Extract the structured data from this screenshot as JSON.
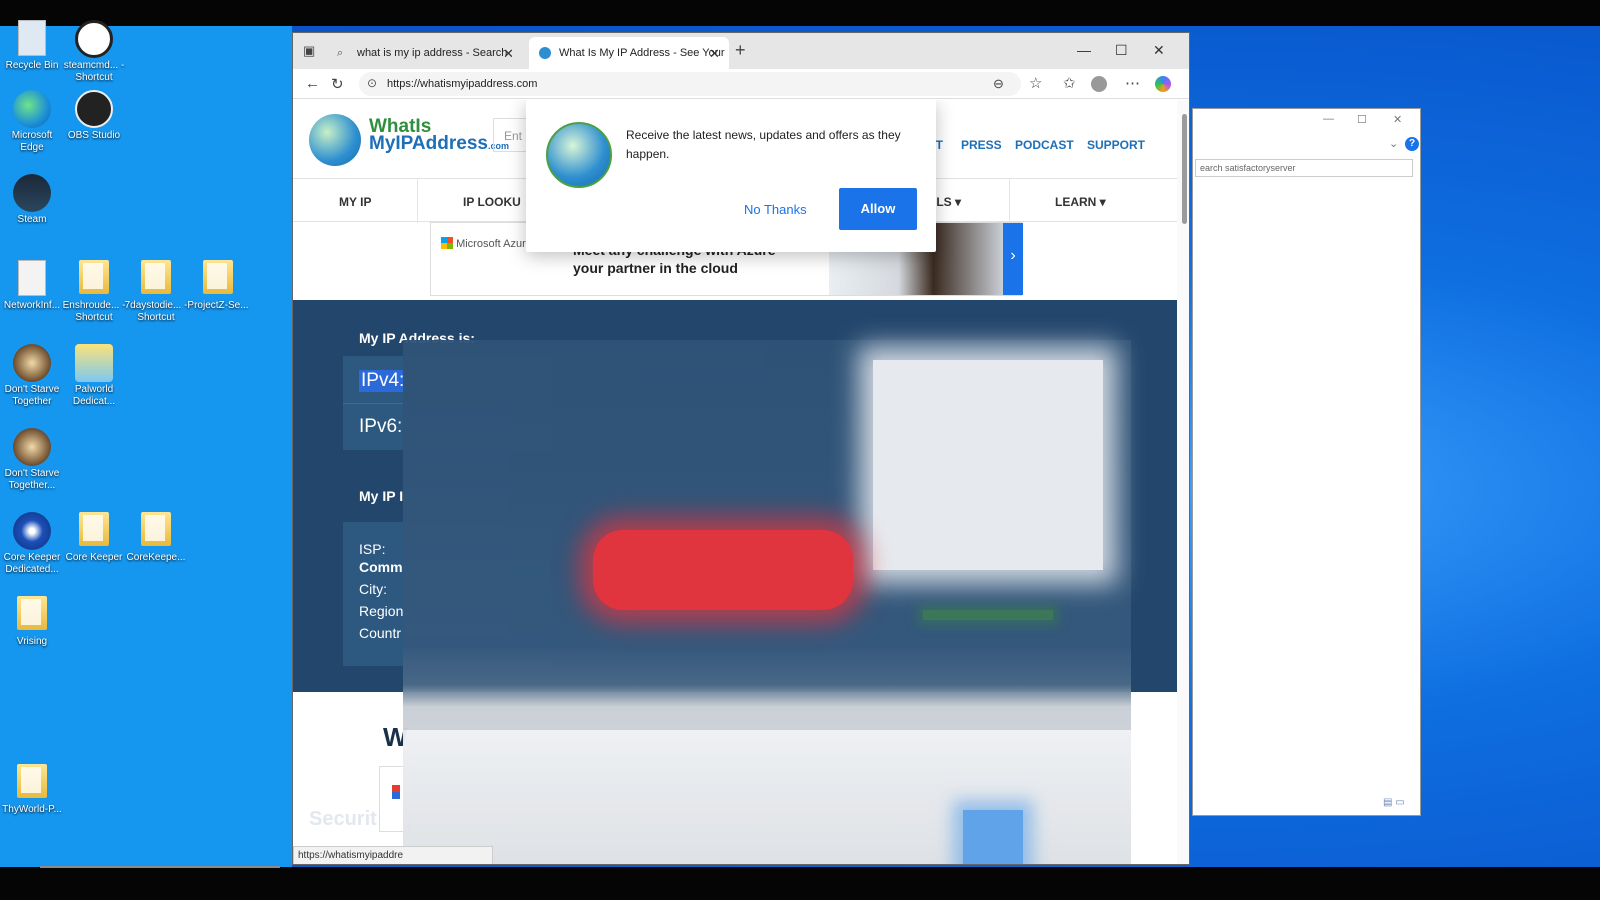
{
  "desktop": {
    "icons": [
      {
        "label": "Recycle Bin",
        "icon": "recycle-bin-icon"
      },
      {
        "label": "steamcmd... - Shortcut",
        "icon": "steam-icon"
      },
      {
        "label": "Microsoft Edge",
        "icon": "edge-icon"
      },
      {
        "label": "OBS Studio",
        "icon": "obs-icon"
      },
      {
        "label": "Steam",
        "icon": "steam-icon"
      },
      {
        "label": "NetworkInf...",
        "icon": "document-icon"
      },
      {
        "label": "Enshroude... - Shortcut",
        "icon": "folder-icon"
      },
      {
        "label": "7daystodie... - Shortcut",
        "icon": "folder-icon"
      },
      {
        "label": "ProjectZ-Se...",
        "icon": "folder-icon"
      },
      {
        "label": "Don't Starve Together",
        "icon": "dont-starve-icon"
      },
      {
        "label": "Palworld Dedicat...",
        "icon": "palworld-icon"
      },
      {
        "label": "Don't Starve Together...",
        "icon": "dont-starve-icon"
      },
      {
        "label": "Core Keeper Dedicated...",
        "icon": "core-keeper-icon"
      },
      {
        "label": "Core Keeper",
        "icon": "folder-icon"
      },
      {
        "label": "CoreKeepe...",
        "icon": "folder-icon"
      },
      {
        "label": "Vrising",
        "icon": "folder-icon"
      },
      {
        "label": "ThyWorld-P...",
        "icon": "folder-icon"
      }
    ]
  },
  "browser": {
    "tabs": [
      {
        "label": "what is my ip address - Search",
        "icon": "search-icon"
      },
      {
        "label": "What Is My IP Address - See Your",
        "icon": "globe-icon"
      }
    ],
    "url": "https://whatismyipaddress.com",
    "status_url": "https://whatismyipaddre"
  },
  "site": {
    "logo_line1": "WhatIs",
    "logo_line2": "MyIPAddress",
    "logo_suffix": ".com",
    "search_placeholder": "Ent",
    "top_links": [
      "UT",
      "PRESS",
      "PODCAST",
      "SUPPORT"
    ],
    "nav": [
      "MY IP",
      "IP LOOKU",
      "OLS ▾",
      "LEARN ▾"
    ],
    "ad": {
      "brand": "Microsoft Azure",
      "text": "Meet any challenge with Azure— your partner in the cloud"
    },
    "ip": {
      "heading": "My IP Address is:",
      "ipv4": "IPv4:",
      "ipv6": "IPv6:",
      "info_heading": "My IP I",
      "isp": "ISP:",
      "isp_value": "Comm",
      "city": "City:",
      "region": "Region",
      "country": "Countr"
    },
    "below_heading": "W",
    "securit": "Securit"
  },
  "popup": {
    "message": "Receive the latest news, updates and offers as they happen.",
    "no_thanks": "No Thanks",
    "allow": "Allow"
  },
  "explorer": {
    "search_placeholder": "earch satisfactoryserver",
    "help": "?"
  }
}
